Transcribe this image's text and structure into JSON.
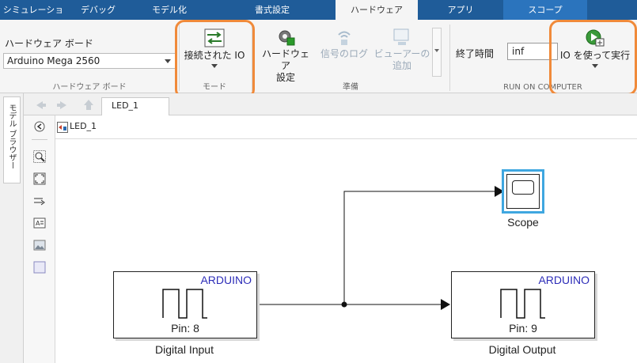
{
  "tabs": [
    "シミュレーション",
    "デバッグ",
    "モデル化",
    "書式設定",
    "ハードウェア",
    "アプリ",
    "スコープ"
  ],
  "hardware_board": {
    "label": "ハードウェア ボード",
    "value": "Arduino Mega 2560",
    "section": "ハードウェア ボード"
  },
  "mode": {
    "button": "接続された IO",
    "section": "モード"
  },
  "prepare": {
    "hw_settings_line1": "ハードウェア",
    "hw_settings_line2": "設定",
    "signal_log": "信号のログ",
    "add_viewer_line1": "ビューアーの",
    "add_viewer_line2": "追加",
    "section": "準備"
  },
  "run": {
    "stop_time_label": "終了時間",
    "stop_time_value": "inf",
    "run_button": "IO を使って実行",
    "section": "RUN ON COMPUTER"
  },
  "browser_tab": "モデル ブラウザー",
  "model_tab": "LED_1",
  "breadcrumb": "LED_1",
  "blocks": {
    "digital_input": {
      "header": "ARDUINO",
      "pin": "Pin: 8",
      "caption": "Digital Input"
    },
    "digital_output": {
      "header": "ARDUINO",
      "pin": "Pin: 9",
      "caption": "Digital Output"
    },
    "scope": {
      "caption": "Scope"
    }
  },
  "colors": {
    "tabbar": "#1f5c99",
    "highlight": "#f08a3a",
    "block_label": "#2d2db8",
    "scope_selected": "#3fa7e0"
  }
}
